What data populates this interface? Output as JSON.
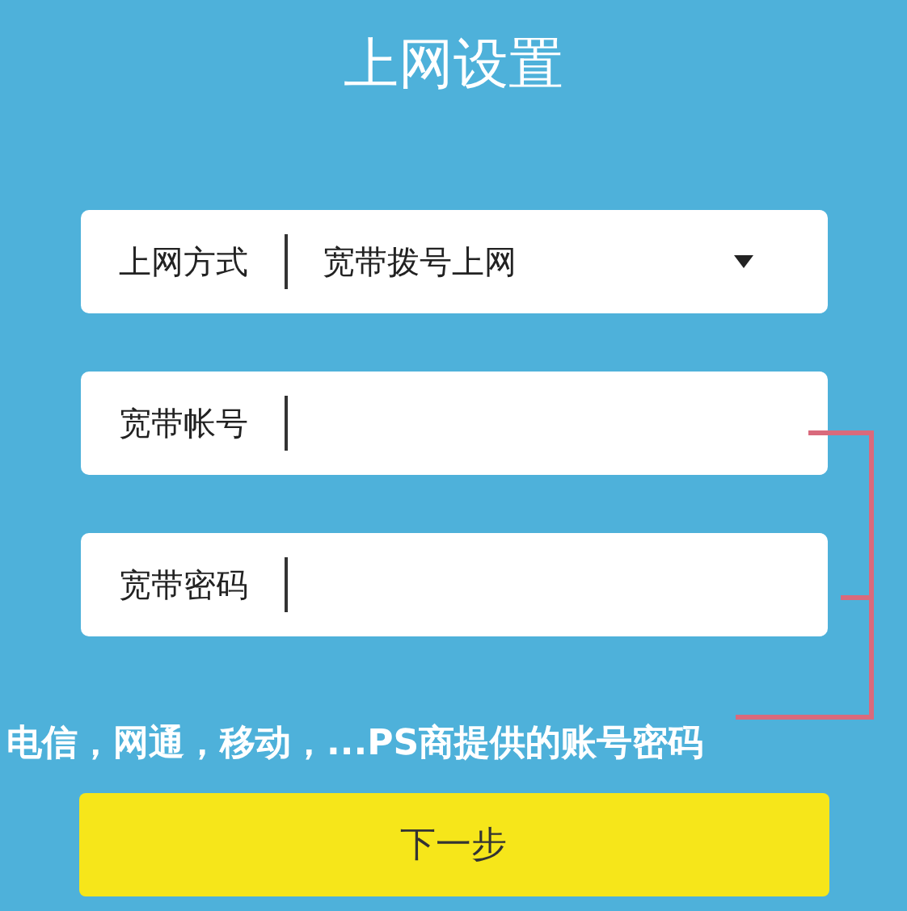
{
  "title": "上网设置",
  "connection_type": {
    "label": "上网方式",
    "value": "宽带拨号上网"
  },
  "fields": [
    {
      "label": "宽带帐号"
    },
    {
      "label": "宽带密码"
    }
  ],
  "annotation": "电信，网通，移动，...PS商提供的账号密码",
  "next_button": "下一步"
}
